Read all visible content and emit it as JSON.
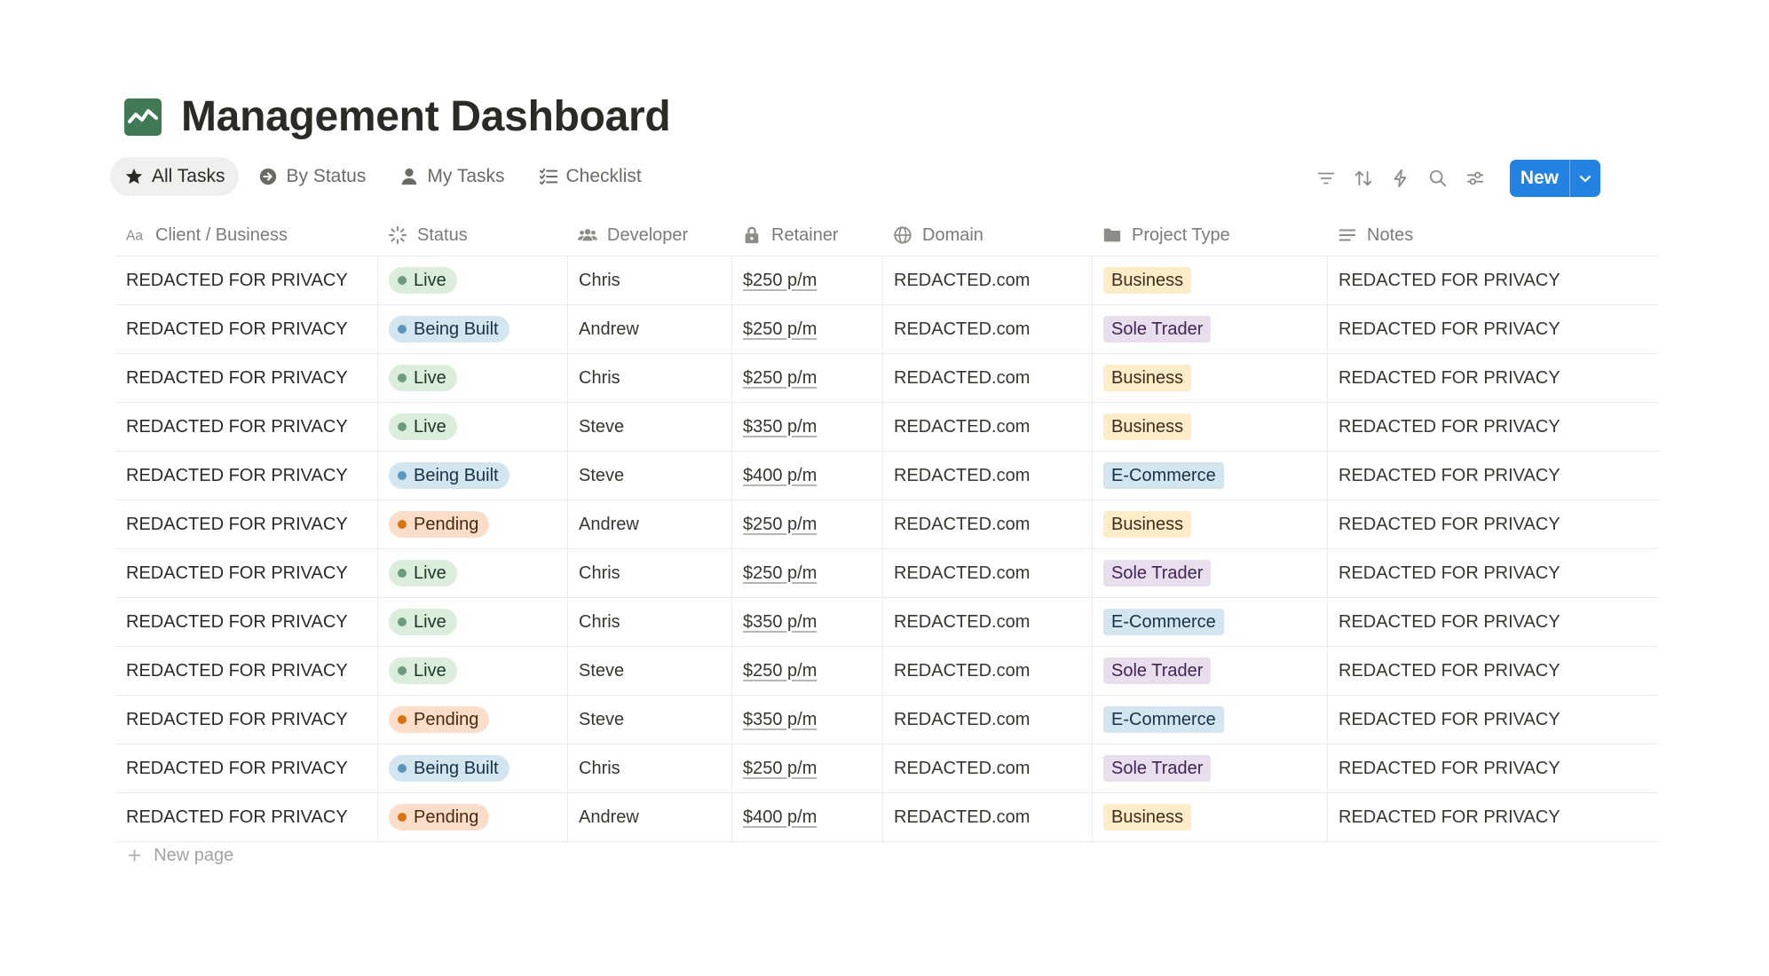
{
  "page": {
    "title": "Management Dashboard",
    "icon": "trend-chart-icon"
  },
  "tabs": [
    {
      "label": "All Tasks",
      "icon": "star-icon",
      "active": true
    },
    {
      "label": "By Status",
      "icon": "circle-arrow-icon",
      "active": false
    },
    {
      "label": "My Tasks",
      "icon": "person-icon",
      "active": false
    },
    {
      "label": "Checklist",
      "icon": "checklist-icon",
      "active": false
    }
  ],
  "toolbar": {
    "icons": [
      "filter-icon",
      "sort-icon",
      "lightning-icon",
      "search-icon",
      "settings-sliders-icon"
    ],
    "new_label": "New"
  },
  "columns": [
    {
      "label": "Client / Business",
      "icon": "text-type-icon"
    },
    {
      "label": "Status",
      "icon": "status-spinner-icon"
    },
    {
      "label": "Developer",
      "icon": "people-icon"
    },
    {
      "label": "Retainer",
      "icon": "lock-icon"
    },
    {
      "label": "Domain",
      "icon": "globe-icon"
    },
    {
      "label": "Project Type",
      "icon": "folder-icon"
    },
    {
      "label": "Notes",
      "icon": "lines-icon"
    }
  ],
  "status_styles": {
    "Live": {
      "bg": "#dbeddb",
      "dot": "#6c9b7d",
      "text": "#1c3829"
    },
    "Being Built": {
      "bg": "#d3e5ef",
      "dot": "#5b97bd",
      "text": "#183347"
    },
    "Pending": {
      "bg": "#fadec9",
      "dot": "#d9730d",
      "text": "#49290e"
    }
  },
  "type_styles": {
    "Business": {
      "bg": "#fdecc8",
      "text": "#402c1b"
    },
    "Sole Trader": {
      "bg": "#e8deee",
      "text": "#412454"
    },
    "E-Commerce": {
      "bg": "#d3e5ef",
      "text": "#183347"
    }
  },
  "rows": [
    {
      "client": "REDACTED FOR PRIVACY",
      "status": "Live",
      "developer": "Chris",
      "retainer": "$250 p/m",
      "domain": "REDACTED.com",
      "type": "Business",
      "notes": "REDACTED FOR PRIVACY"
    },
    {
      "client": "REDACTED FOR PRIVACY",
      "status": "Being Built",
      "developer": "Andrew",
      "retainer": "$250 p/m",
      "domain": "REDACTED.com",
      "type": "Sole Trader",
      "notes": "REDACTED FOR PRIVACY"
    },
    {
      "client": "REDACTED FOR PRIVACY",
      "status": "Live",
      "developer": "Chris",
      "retainer": "$250 p/m",
      "domain": "REDACTED.com",
      "type": "Business",
      "notes": "REDACTED FOR PRIVACY"
    },
    {
      "client": "REDACTED FOR PRIVACY",
      "status": "Live",
      "developer": "Steve",
      "retainer": "$350 p/m",
      "domain": "REDACTED.com",
      "type": "Business",
      "notes": "REDACTED FOR PRIVACY"
    },
    {
      "client": "REDACTED FOR PRIVACY",
      "status": "Being Built",
      "developer": "Steve",
      "retainer": "$400 p/m",
      "domain": "REDACTED.com",
      "type": "E-Commerce",
      "notes": "REDACTED FOR PRIVACY"
    },
    {
      "client": "REDACTED FOR PRIVACY",
      "status": "Pending",
      "developer": "Andrew",
      "retainer": "$250 p/m",
      "domain": "REDACTED.com",
      "type": "Business",
      "notes": "REDACTED FOR PRIVACY"
    },
    {
      "client": "REDACTED FOR PRIVACY",
      "status": "Live",
      "developer": "Chris",
      "retainer": "$250 p/m",
      "domain": "REDACTED.com",
      "type": "Sole Trader",
      "notes": "REDACTED FOR PRIVACY"
    },
    {
      "client": "REDACTED FOR PRIVACY",
      "status": "Live",
      "developer": "Chris",
      "retainer": "$350 p/m",
      "domain": "REDACTED.com",
      "type": "E-Commerce",
      "notes": "REDACTED FOR PRIVACY"
    },
    {
      "client": "REDACTED FOR PRIVACY",
      "status": "Live",
      "developer": "Steve",
      "retainer": "$250 p/m",
      "domain": "REDACTED.com",
      "type": "Sole Trader",
      "notes": "REDACTED FOR PRIVACY"
    },
    {
      "client": "REDACTED FOR PRIVACY",
      "status": "Pending",
      "developer": "Steve",
      "retainer": "$350 p/m",
      "domain": "REDACTED.com",
      "type": "E-Commerce",
      "notes": "REDACTED FOR PRIVACY"
    },
    {
      "client": "REDACTED FOR PRIVACY",
      "status": "Being Built",
      "developer": "Chris",
      "retainer": "$250 p/m",
      "domain": "REDACTED.com",
      "type": "Sole Trader",
      "notes": "REDACTED FOR PRIVACY"
    },
    {
      "client": "REDACTED FOR PRIVACY",
      "status": "Pending",
      "developer": "Andrew",
      "retainer": "$400 p/m",
      "domain": "REDACTED.com",
      "type": "Business",
      "notes": "REDACTED FOR PRIVACY"
    }
  ],
  "footer": {
    "new_page_label": "New page"
  }
}
